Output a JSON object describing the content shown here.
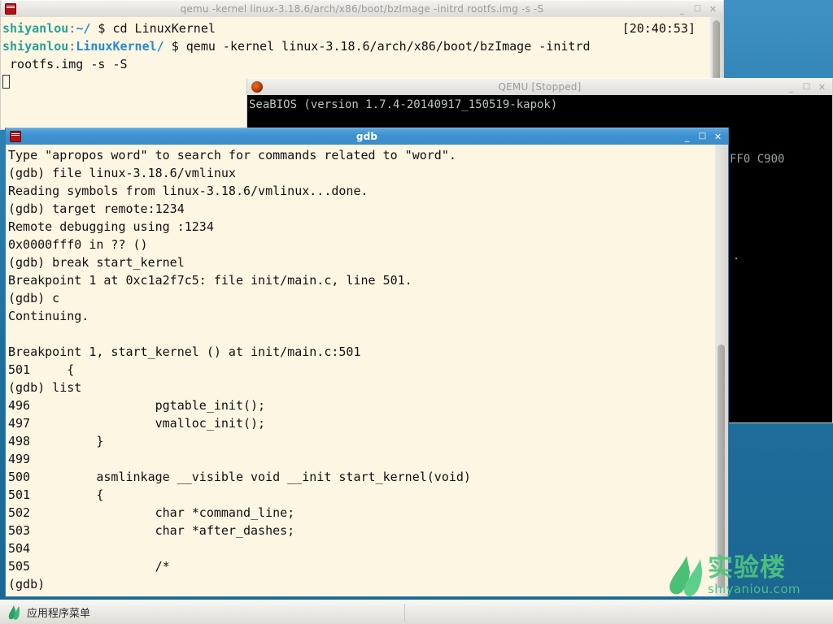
{
  "desktop": {
    "background_top": "#3f92c3",
    "background_bottom": "#1a6690"
  },
  "terminal_window": {
    "title": "qemu -kernel linux-3.18.6/arch/x86/boot/bzImage -initrd rootfs.img -s -S",
    "icon": "terminal-icon",
    "minimize_label": "_",
    "maximize_label": "□",
    "close_label": "✕",
    "clock": "[20:40:53]",
    "lines": [
      {
        "host": "shiyanlou",
        "sep": ":",
        "path": "~/",
        "rest": " $ cd LinuxKernel"
      },
      {
        "host": "shiyanlou",
        "sep": ":",
        "path": "LinuxKernel/",
        "rest": " $ qemu -kernel linux-3.18.6/arch/x86/boot/bzImage -initrd"
      },
      {
        "host": "",
        "sep": "",
        "path": "",
        "rest": " rootfs.img -s -S"
      }
    ]
  },
  "qemu_window": {
    "title": "QEMU [Stopped]",
    "icon": "qemu-icon",
    "minimize_label": "_",
    "maximize_label": "□",
    "close_label": "✕",
    "console_text": "SeaBIOS (version 1.7.4-20140917_150519-kapok)",
    "right_fragment": "FF0 C900"
  },
  "gdb_window": {
    "title": "gdb",
    "icon": "terminal-icon",
    "minimize_label": "_",
    "maximize_label": "□",
    "close_label": "✕",
    "output": "Type \"apropos word\" to search for commands related to \"word\".\n(gdb) file linux-3.18.6/vmlinux\nReading symbols from linux-3.18.6/vmlinux...done.\n(gdb) target remote:1234\nRemote debugging using :1234\n0x0000fff0 in ?? ()\n(gdb) break start_kernel\nBreakpoint 1 at 0xc1a2f7c5: file init/main.c, line 501.\n(gdb) c\nContinuing.\n\nBreakpoint 1, start_kernel () at init/main.c:501\n501\t{\n(gdb) list\n496\t            pgtable_init();\n497\t            vmalloc_init();\n498\t    }\n499\t\n500\t    asmlinkage __visible void __init start_kernel(void)\n501\t    {\n502\t            char *command_line;\n503\t            char *after_dashes;\n504\t\n505\t            /*\n(gdb)"
  },
  "watermark": {
    "cn_text": "实验楼",
    "url_text": "shiyaniou.com",
    "color": "#4ec57e"
  },
  "taskbar": {
    "app_menu_label": "应用程序菜单",
    "app_menu_icon": "shiyanlou-leaf-icon"
  }
}
